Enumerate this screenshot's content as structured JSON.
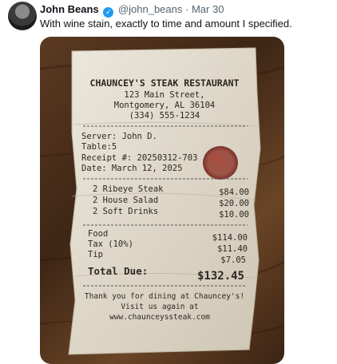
{
  "tweet": {
    "author_name": "John Beans",
    "verified_icon": "verified-badge-icon",
    "handle": "@john_beans",
    "separator": "·",
    "date": "Mar 30",
    "text": "With wine stain, exactly to time and amount I specified."
  },
  "receipt": {
    "restaurant_name": "CHAUNCEY'S STEAK RESTAURANT",
    "address_line1": "123 Main Street,",
    "address_line2": "Montgomery, AL 36104",
    "phone": "(334) 555-1234",
    "server": "Server: John D.",
    "table": "Table:5",
    "receipt_no": "Receipt #: 20250312-703",
    "date": "Date: March 12, 2025",
    "items": [
      {
        "label": "2  Ribeye Steak",
        "price": "$84.00"
      },
      {
        "label": "2  House Salad",
        "price": "$20.00"
      },
      {
        "label": "2  Soft Drinks",
        "price": "$10.00"
      }
    ],
    "food_label": "Food",
    "food_value": "$114.00",
    "tax_label": "Tax (10%)",
    "tax_value": "$11.40",
    "tip_label": "Tip",
    "tip_value": "$7.05",
    "total_label": "Total Due:",
    "total_value": "$132.45",
    "thanks_line1": "Thank you for dining at Chauncey's!",
    "thanks_line2": "Visit us again at",
    "website": "www.chaunceyssteak.com"
  },
  "colors": {
    "verified": "#1d9bf0",
    "paper": "#e7e1d4",
    "wine_stain": "#8a2a1f",
    "wood": "#4a2e1a"
  }
}
